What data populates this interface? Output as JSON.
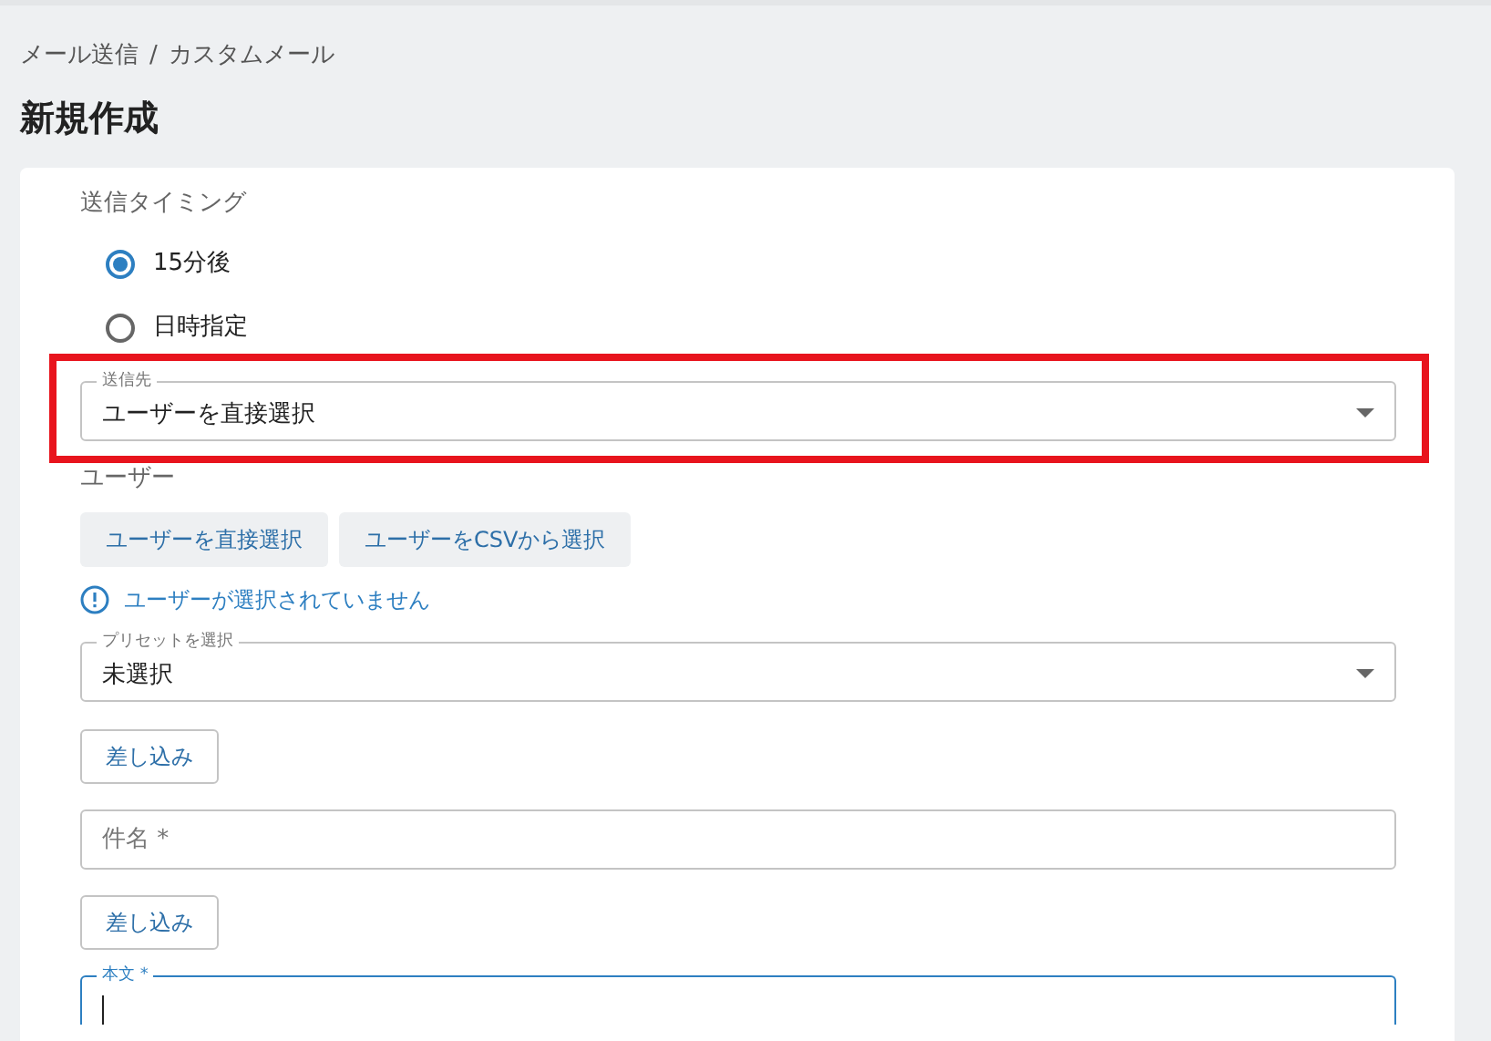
{
  "breadcrumb": [
    "メール送信",
    "/",
    "カスタムメール"
  ],
  "page_title": "新規作成",
  "timing": {
    "label": "送信タイミング",
    "options": [
      {
        "label": "15分後",
        "selected": true
      },
      {
        "label": "日時指定",
        "selected": false
      }
    ]
  },
  "recipient": {
    "label": "送信先",
    "value": "ユーザーを直接選択",
    "highlighted": true
  },
  "users": {
    "label": "ユーザー",
    "buttons": [
      "ユーザーを直接選択",
      "ユーザーをCSVから選択"
    ],
    "notice": "ユーザーが選択されていません"
  },
  "preset": {
    "label": "プリセットを選択",
    "value": "未選択"
  },
  "insert_button_1": "差し込み",
  "subject": {
    "placeholder": "件名 *"
  },
  "insert_button_2": "差し込み",
  "body": {
    "label": "本文 *",
    "focused": true
  }
}
